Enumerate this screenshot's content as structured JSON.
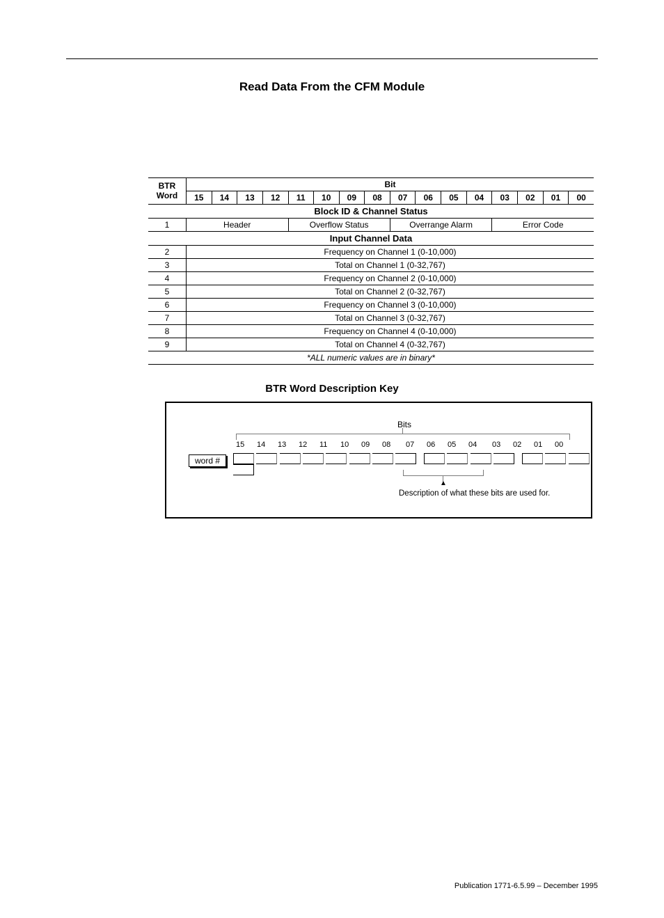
{
  "page_title": "Read Data From the CFM Module",
  "table": {
    "col_btr_word": "BTR\nWord",
    "col_bit": "Bit",
    "bits": [
      "15",
      "14",
      "13",
      "12",
      "11",
      "10",
      "09",
      "08",
      "07",
      "06",
      "05",
      "04",
      "03",
      "02",
      "01",
      "00"
    ],
    "section1": "Block ID & Channel Status",
    "row1": {
      "word": "1",
      "header": "Header",
      "overflow": "Overflow Status",
      "overrange": "Overrange Alarm",
      "errcode": "Error Code"
    },
    "section2": "Input Channel Data",
    "rows": [
      {
        "word": "2",
        "desc": "Frequency on Channel 1 (0-10,000)"
      },
      {
        "word": "3",
        "desc": "Total on Channel 1 (0-32,767)"
      },
      {
        "word": "4",
        "desc": "Frequency on Channel 2 (0-10,000)"
      },
      {
        "word": "5",
        "desc": "Total on Channel 2  (0-32,767)"
      },
      {
        "word": "6",
        "desc": "Frequency on Channel 3 (0-10,000)"
      },
      {
        "word": "7",
        "desc": "Total on Channel 3 (0-32,767)"
      },
      {
        "word": "8",
        "desc": "Frequency on Channel 4 (0-10,000)"
      },
      {
        "word": "9",
        "desc": "Total on Channel 4 (0-32,767)"
      }
    ],
    "footnote": "*ALL numeric values are in binary*"
  },
  "key": {
    "title": "BTR Word Description Key",
    "bits_label": "Bits",
    "bitnums": [
      "15",
      "14",
      "13",
      "12",
      "11",
      "10",
      "09",
      "08",
      "07",
      "06",
      "05",
      "04",
      "03",
      "02",
      "01",
      "00"
    ],
    "word_label": "word #",
    "desc": "Description of what these bits are used for."
  },
  "publication": "Publication 1771-6.5.99 – December 1995"
}
